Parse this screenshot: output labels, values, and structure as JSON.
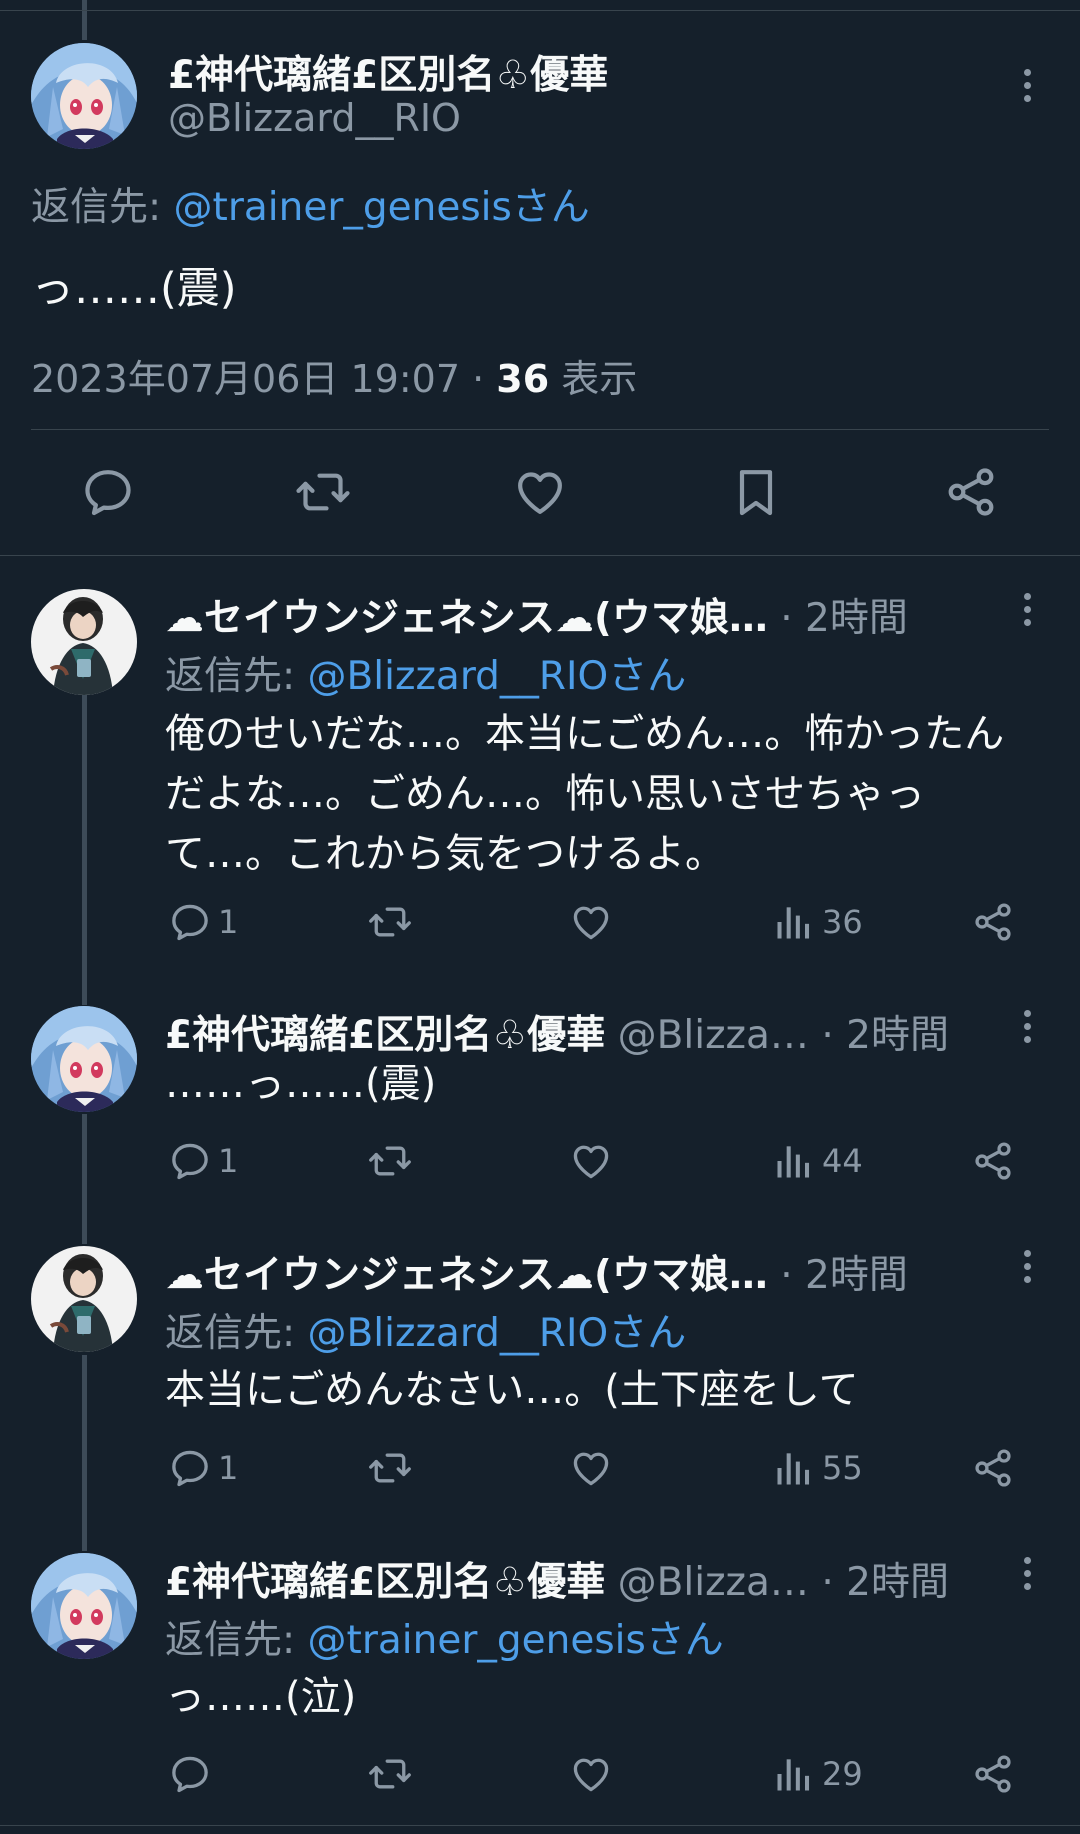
{
  "main_tweet": {
    "display_name": "£神代璃緒£区別名♧優華",
    "handle": "@Blizzard__RIO",
    "reply_prefix": "返信先:",
    "reply_to": "@trainer_genesisさん",
    "text": "っ……(震)",
    "timestamp": "2023年07月06日 19:07",
    "sep": "·",
    "views_count": "36",
    "views_label": "表示"
  },
  "replies": [
    {
      "display_name": "☁セイウンジェネシス☁(ウマ娘…",
      "time": "· 2時間",
      "reply_prefix": "返信先:",
      "reply_to": "@Blizzard__RIOさん",
      "lines": [
        "俺のせいだな…。本当にごめん…。怖かったん",
        "だよな…。ごめん…。怖い思いさせちゃっ",
        "て…。これから気をつけるよ。"
      ],
      "reply_count": "1",
      "views": "36"
    },
    {
      "display_name": "£神代璃緒£区別名♧優華",
      "handle": "@Blizza…",
      "time": "· 2時間",
      "lines": [
        "……っ……(震)"
      ],
      "reply_count": "1",
      "views": "44"
    },
    {
      "display_name": "☁セイウンジェネシス☁(ウマ娘…",
      "time": "· 2時間",
      "reply_prefix": "返信先:",
      "reply_to": "@Blizzard__RIOさん",
      "lines": [
        "本当にごめんなさい…。(土下座をして"
      ],
      "reply_count": "1",
      "views": "55"
    },
    {
      "display_name": "£神代璃緒£区別名♧優華",
      "handle": "@Blizza…",
      "time": "· 2時間",
      "reply_prefix": "返信先:",
      "reply_to": "@trainer_genesisさん",
      "lines": [
        "っ……(泣)"
      ],
      "views": "29"
    }
  ],
  "icons": [
    "reply-icon",
    "retweet-icon",
    "like-icon",
    "bookmark-icon",
    "share-icon",
    "views-icon",
    "more-icon"
  ],
  "colors": {
    "background": "#15202b",
    "link": "#4e9ee8",
    "muted": "#8b98a5",
    "divider": "#38444d"
  }
}
